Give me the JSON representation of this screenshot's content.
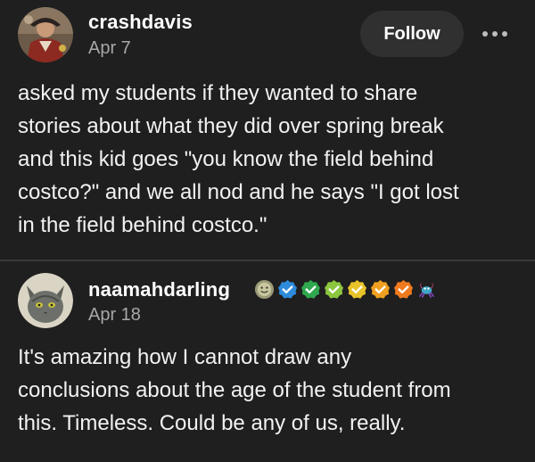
{
  "posts": [
    {
      "username": "crashdavis",
      "date": "Apr 7",
      "follow_label": "Follow",
      "more_icon": "more-horizontal-icon",
      "body": "asked my students if they wanted to share\nstories about what they did over spring break\nand this kid goes \"you know the field behind\ncostco?\" and we all nod and he says \"I got lost\nin the field behind costco.\""
    },
    {
      "username": "naamahdarling",
      "date": "Apr 18",
      "badges": [
        "smiley-badge-icon",
        "blue-check-badge-icon",
        "green-check-badge-icon",
        "lime-check-badge-icon",
        "yellow-check-badge-icon",
        "orange-check-badge-icon",
        "orange-check-badge-icon",
        "crab-badge-icon"
      ],
      "body": "It's amazing how I cannot draw any\nconclusions about the age of the student from\nthis. Timeless. Could be any of us, really."
    }
  ],
  "colors": {
    "background": "#1f1f1f",
    "follow_button": "#303030",
    "date_text": "#a8a8a8",
    "divider": "#3a3a3a"
  }
}
